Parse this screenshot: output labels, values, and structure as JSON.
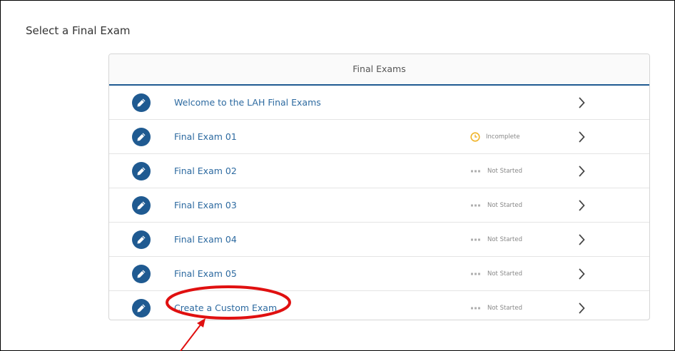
{
  "page": {
    "title": "Select a Final Exam"
  },
  "panel": {
    "header": "Final Exams"
  },
  "colors": {
    "accent": "#1f5a91",
    "link": "#2d6aa0",
    "incomplete": "#f0b429",
    "annotation": "#e01010"
  },
  "exams": [
    {
      "title": "Welcome to the LAH Final Exams",
      "status": "",
      "status_icon": ""
    },
    {
      "title": "Final Exam 01",
      "status": "Incomplete",
      "status_icon": "clock-icon"
    },
    {
      "title": "Final Exam 02",
      "status": "Not Started",
      "status_icon": "dots-icon"
    },
    {
      "title": "Final Exam 03",
      "status": "Not Started",
      "status_icon": "dots-icon"
    },
    {
      "title": "Final Exam 04",
      "status": "Not Started",
      "status_icon": "dots-icon"
    },
    {
      "title": "Final Exam 05",
      "status": "Not Started",
      "status_icon": "dots-icon"
    },
    {
      "title": "Create a Custom Exam",
      "status": "Not Started",
      "status_icon": "dots-icon"
    }
  ]
}
